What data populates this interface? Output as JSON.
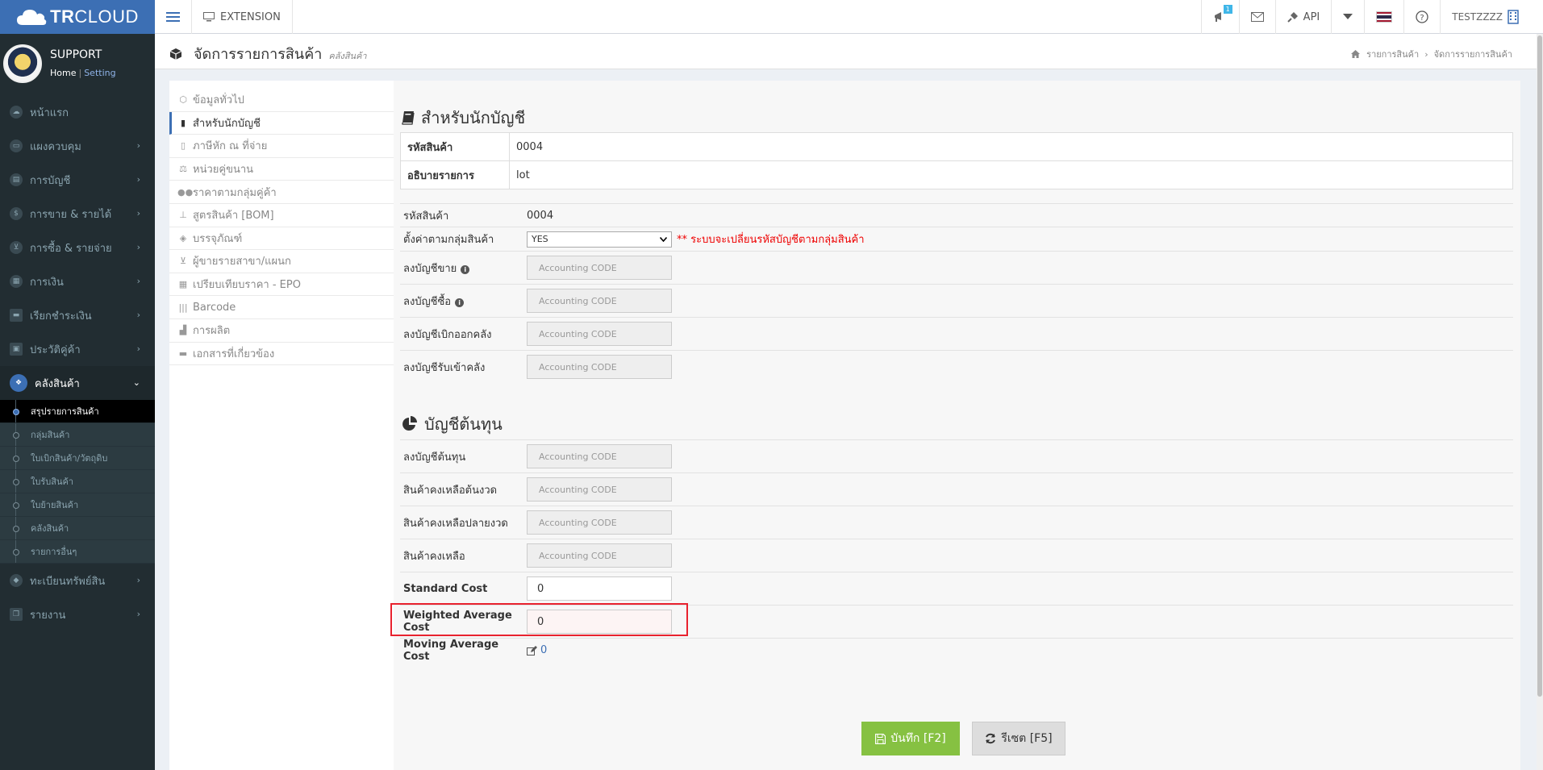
{
  "topbar": {
    "logo_bold": "TR",
    "logo_thin": "CLOUD",
    "extension_label": "EXTENSION",
    "notification_count": "1",
    "api_label": "API",
    "username": "TESTZZZZ"
  },
  "sidebar": {
    "user_name": "SUPPORT",
    "home_link": "Home",
    "setting_link": "Setting",
    "items": [
      {
        "label": "หน้าแรก"
      },
      {
        "label": "แผงควบคุม"
      },
      {
        "label": "การบัญชี"
      },
      {
        "label": "การขาย & รายได้"
      },
      {
        "label": "การซื้อ & รายจ่าย"
      },
      {
        "label": "การเงิน"
      },
      {
        "label": "เรียกชำระเงิน"
      },
      {
        "label": "ประวัติคู่ค้า"
      },
      {
        "label": "คลังสินค้า"
      },
      {
        "label": "ทะเบียนทรัพย์สิน"
      },
      {
        "label": "รายงาน"
      }
    ],
    "subitems": [
      {
        "label": "สรุปรายการสินค้า"
      },
      {
        "label": "กลุ่มสินค้า"
      },
      {
        "label": "ใบเบิกสินค้า/วัตถุดิบ"
      },
      {
        "label": "ใบรับสินค้า"
      },
      {
        "label": "ใบย้ายสินค้า"
      },
      {
        "label": "คลังสินค้า"
      },
      {
        "label": "รายการอื่นๆ"
      }
    ]
  },
  "header": {
    "title": "จัดการรายการสินค้า",
    "subtitle": "คลังสินค้า",
    "breadcrumb_1": "รายการสินค้า",
    "breadcrumb_2": "จัดการรายการสินค้า"
  },
  "tabs": [
    {
      "label": "ข้อมูลทั่วไป"
    },
    {
      "label": "สำหรับนักบัญชี"
    },
    {
      "label": "ภาษีหัก ณ ที่จ่าย"
    },
    {
      "label": "หน่วยคู่ขนาน"
    },
    {
      "label": "ราคาตามกลุ่มคู่ค้า"
    },
    {
      "label": "สูตรสินค้า [BOM]"
    },
    {
      "label": "บรรจุภัณฑ์"
    },
    {
      "label": "ผู้ขายรายสาขา/แผนก"
    },
    {
      "label": "เปรียบเทียบราคา - EPO"
    },
    {
      "label": "Barcode"
    },
    {
      "label": "การผลิต"
    },
    {
      "label": "เอกสารที่เกี่ยวข้อง"
    }
  ],
  "accountant": {
    "section_title": "สำหรับนักบัญชี",
    "info_table": [
      {
        "label": "รหัสสินค้า",
        "value": "0004"
      },
      {
        "label": "อธิบายรายการ",
        "value": "lot"
      }
    ],
    "product_code_label": "รหัสสินค้า",
    "product_code_value": "0004",
    "group_setting_label": "ตั้งค่าตามกลุ่มสินค้า",
    "group_setting_value": "YES",
    "group_setting_warning": "** ระบบจะเปลี่ยนรหัสบัญชีตามกลุ่มสินค้า",
    "accounts": [
      {
        "label": "ลงบัญชีขาย",
        "placeholder": "Accounting CODE"
      },
      {
        "label": "ลงบัญชีซื้อ",
        "placeholder": "Accounting CODE"
      },
      {
        "label": "ลงบัญชีเบิกออกคลัง",
        "placeholder": "Accounting CODE"
      },
      {
        "label": "ลงบัญชีรับเข้าคลัง",
        "placeholder": "Accounting CODE"
      }
    ]
  },
  "cost": {
    "section_title": "บัญชีต้นทุน",
    "accounts": [
      {
        "label": "ลงบัญชีต้นทุน",
        "placeholder": "Accounting CODE"
      },
      {
        "label": "สินค้าคงเหลือต้นงวด",
        "placeholder": "Accounting CODE"
      },
      {
        "label": "สินค้าคงเหลือปลายงวด",
        "placeholder": "Accounting CODE"
      },
      {
        "label": "สินค้าคงเหลือ",
        "placeholder": "Accounting CODE"
      }
    ],
    "standard_cost_label": "Standard Cost",
    "standard_cost_value": "0",
    "weighted_cost_label": "Weighted Average Cost",
    "weighted_cost_value": "0",
    "moving_cost_label": "Moving Average Cost",
    "moving_cost_value": "0"
  },
  "buttons": {
    "save": "บันทึก [F2]",
    "reset": "รีเซต [F5]"
  },
  "colors": {
    "brand": "#3c6fb4",
    "save": "#86c142",
    "highlight": "#e8222e"
  }
}
